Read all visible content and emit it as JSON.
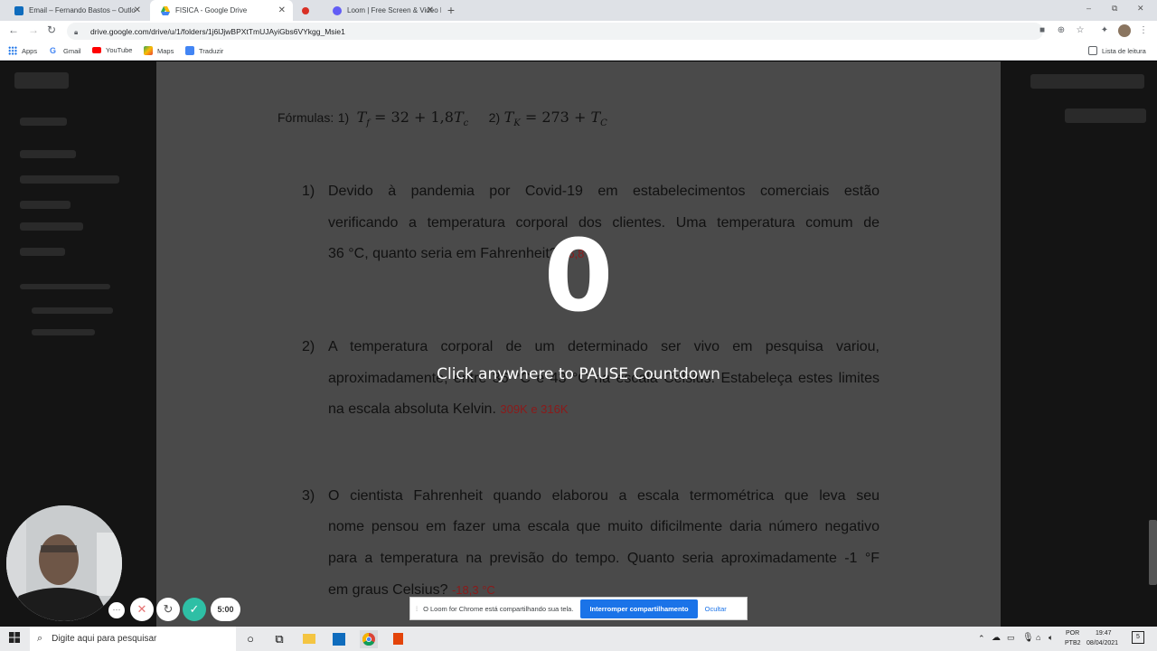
{
  "browser": {
    "tabs": [
      {
        "title": "Email – Fernando Bastos – Outlo",
        "active": false
      },
      {
        "title": "FISICA - Google Drive",
        "active": true
      },
      {
        "title": "Loom | Free Screen & Video Rec",
        "active": false
      }
    ],
    "new_tab": "+",
    "window_controls": {
      "minimize": "–",
      "restore": "⧉",
      "close": "✕"
    },
    "url": "drive.google.com/drive/u/1/folders/1j6lJjwBPXtTmUJAyiGbs6VYkgg_Msie1",
    "bookmarks": [
      {
        "label": "Apps",
        "icon": "apps-grid-icon"
      },
      {
        "label": "Gmail",
        "icon": "google-g-icon"
      },
      {
        "label": "YouTube",
        "icon": "youtube-icon"
      },
      {
        "label": "Maps",
        "icon": "maps-icon"
      },
      {
        "label": "Traduzir",
        "icon": "translate-icon"
      }
    ],
    "reading_list": "Lista de leitura"
  },
  "document": {
    "formulas_label": "Fórmulas:",
    "formula1_num": "1)",
    "formula1": "T_f = 32 + 1,8T_c",
    "formula2_num": "2)",
    "formula2": "T_K = 273 + T_c",
    "questions": [
      {
        "number": "1)",
        "lines": [
          "Devido à pandemia por Covid-19 em estabelecimentos comerciais estão",
          "verificando a temperatura corporal dos clientes.  Uma temperatura comum de",
          "36 °C, quanto seria em Fahrenheit?"
        ],
        "answer": "96,8 °F"
      },
      {
        "number": "2)",
        "lines": [
          "A temperatura corporal de um determinado ser vivo em pesquisa variou,",
          "aproximadamente, entre 36 °C e 43 °C na escala Celsius. Estabeleça estes limites",
          "na escala absoluta Kelvin."
        ],
        "answer": "309K e 316K"
      },
      {
        "number": "3)",
        "lines": [
          "O cientista Fahrenheit quando elaborou a escala termométrica que leva seu",
          "nome pensou em fazer uma escala que muito dificilmente daria número negativo",
          "para a temperatura na previsão do tempo. Quanto seria aproximadamente  -1 °F",
          "em graus Celsius?"
        ],
        "answer": "-18,3 °C"
      }
    ]
  },
  "loom": {
    "countdown": "0",
    "pause_hint": "Click anywhere to PAUSE Countdown",
    "timer": "5:00",
    "controls": {
      "more": "···",
      "cancel": "✕",
      "restart": "↻",
      "confirm": "✓"
    }
  },
  "share_bar": {
    "message": "O Loom for Chrome está compartilhando sua tela.",
    "stop_label": "Interromper compartilhamento",
    "hide_label": "Ocultar"
  },
  "taskbar": {
    "search_placeholder": "Digite aqui para pesquisar",
    "language": "POR",
    "language_sub": "PTB2",
    "time": "19:47",
    "date": "08/04/2021",
    "notification_count": "5"
  },
  "colors": {
    "chrome_tab_bg": "#dee1e6",
    "overlay_page": "#4a4a4a",
    "answer_red": "#8b1a1a",
    "loom_confirm": "#2ebfa5",
    "share_button": "#1a73e8"
  }
}
